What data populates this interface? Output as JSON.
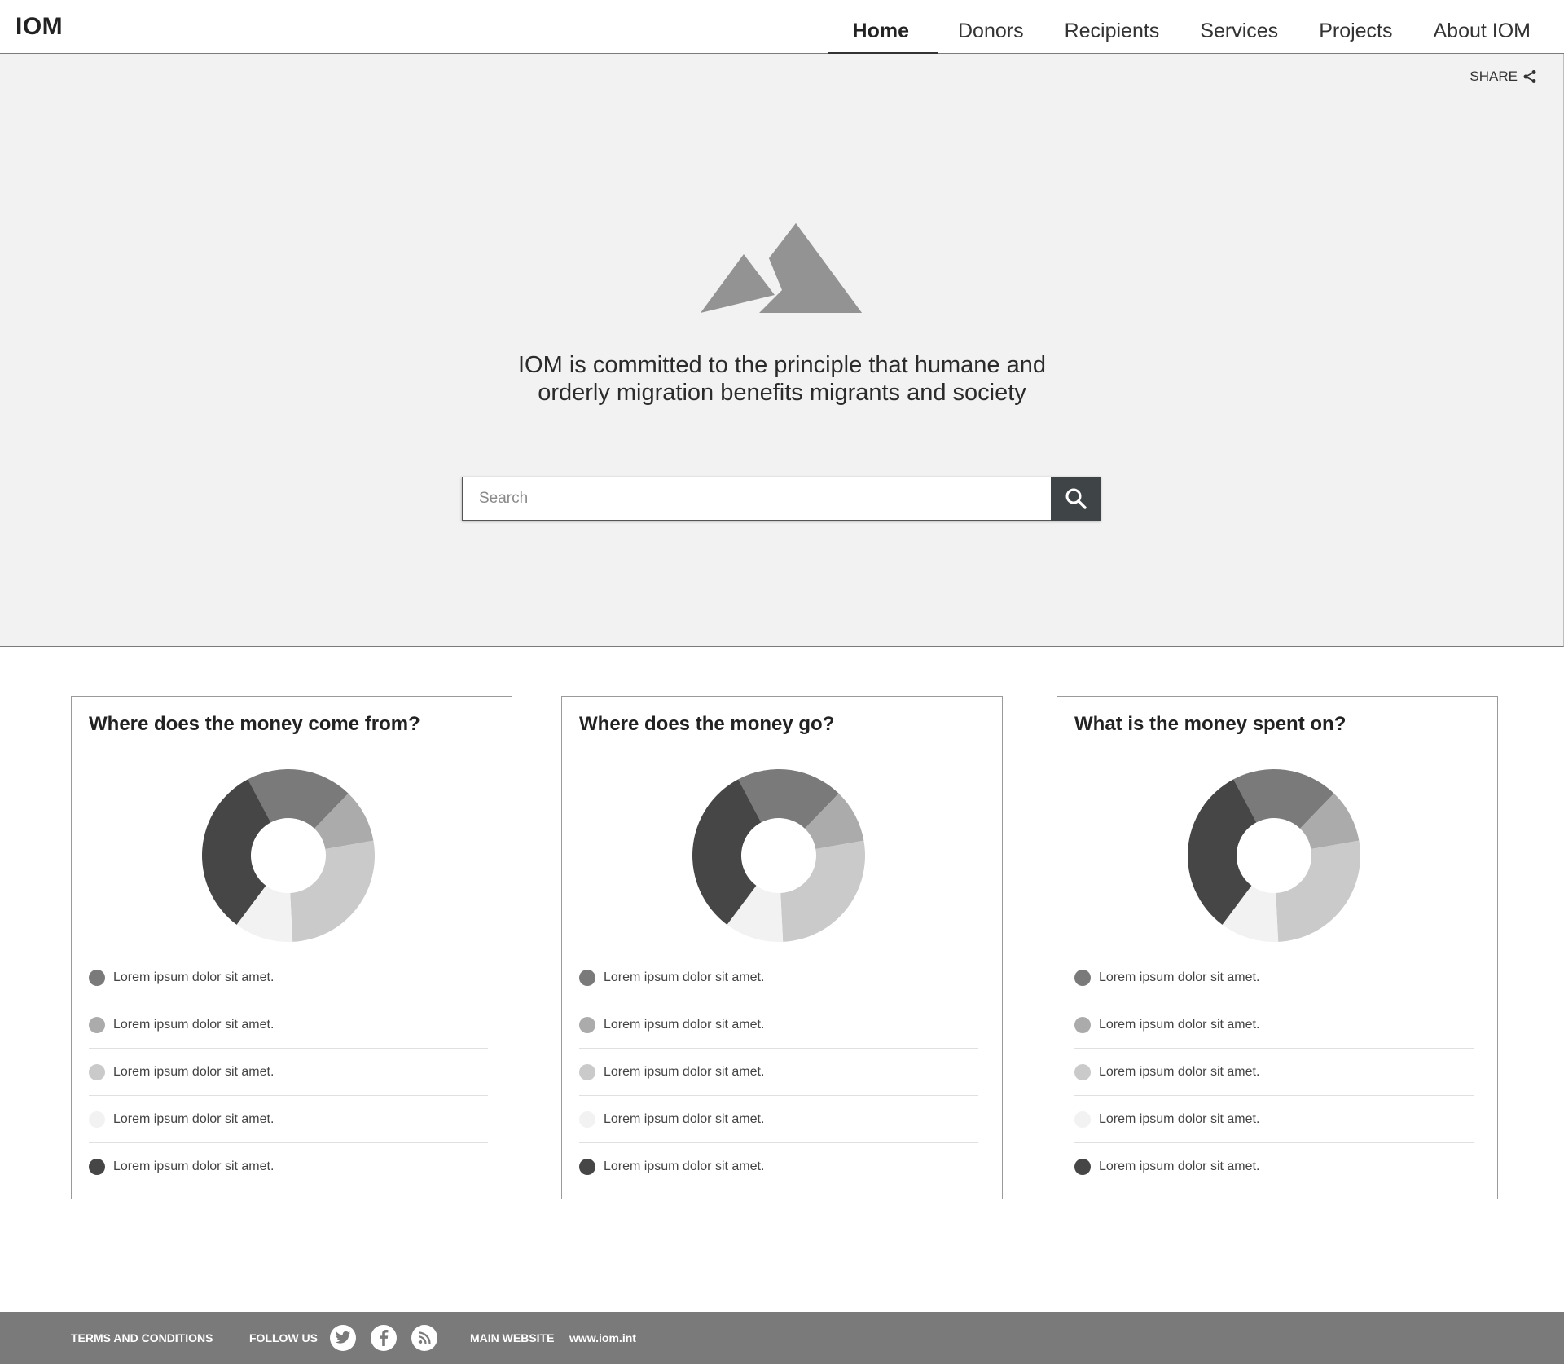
{
  "header": {
    "brand": "IOM",
    "nav": [
      "Home",
      "Donors",
      "Recipients",
      "Services",
      "Projects",
      "About IOM"
    ]
  },
  "hero": {
    "share_label": "SHARE",
    "image_icon": "mountain-image-placeholder-icon",
    "tagline_line1": "IOM is committed to the principle that humane and",
    "tagline_line2": "orderly migration benefits migrants and society",
    "search_placeholder": "Search"
  },
  "cards": [
    {
      "title": "Where does the money come from?",
      "legend": [
        "Lorem ipsum dolor sit amet.",
        "Lorem ipsum dolor sit amet.",
        "Lorem ipsum dolor sit amet.",
        "Lorem ipsum dolor sit amet.",
        "Lorem ipsum dolor sit amet."
      ]
    },
    {
      "title": "Where does the money go?",
      "legend": [
        "Lorem ipsum dolor sit amet.",
        "Lorem ipsum dolor sit amet.",
        "Lorem ipsum dolor sit amet.",
        "Lorem ipsum dolor sit amet.",
        "Lorem ipsum dolor sit amet."
      ]
    },
    {
      "title": "What is the money spent on?",
      "legend": [
        "Lorem ipsum dolor sit amet.",
        "Lorem ipsum dolor sit amet.",
        "Lorem ipsum dolor sit amet.",
        "Lorem ipsum dolor sit amet.",
        "Lorem ipsum dolor sit amet."
      ]
    }
  ],
  "donut": {
    "slices": [
      {
        "value": 20,
        "color": "#7a7a7a"
      },
      {
        "value": 10,
        "color": "#ababab"
      },
      {
        "value": 27,
        "color": "#cacaca"
      },
      {
        "value": 11,
        "color": "#f2f2f2"
      },
      {
        "value": 32,
        "color": "#464646"
      }
    ]
  },
  "footer": {
    "terms": "TERMS AND CONDITIONS",
    "follow": "FOLLOW US",
    "social": [
      "twitter-icon",
      "facebook-icon",
      "rss-icon"
    ],
    "main_website_label": "MAIN WEBSITE",
    "main_website_url": "www.iom.int"
  }
}
